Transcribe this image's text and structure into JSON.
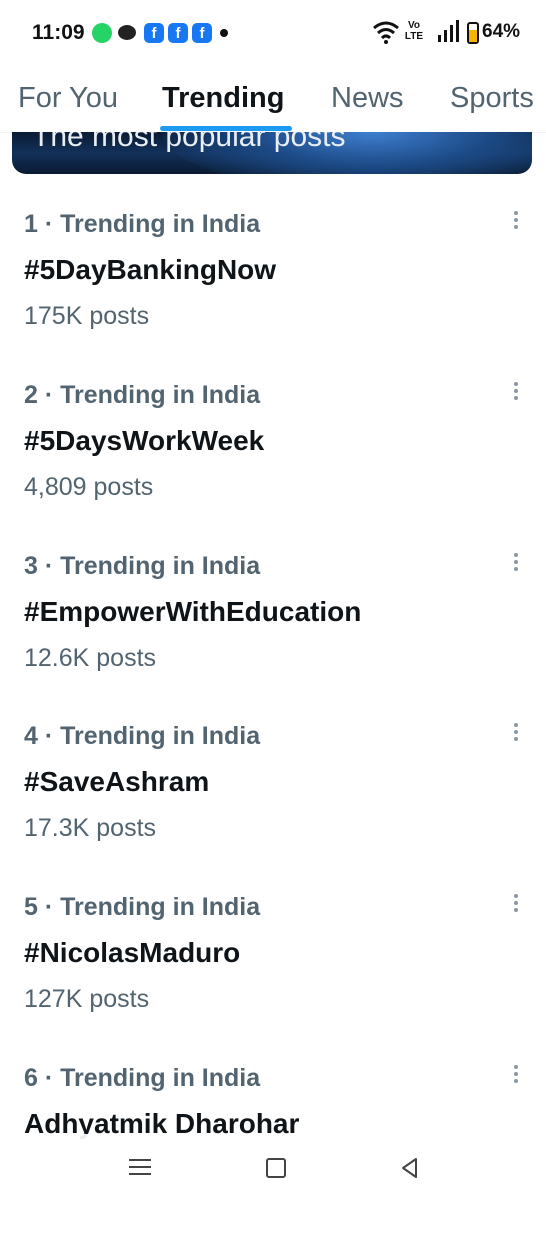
{
  "status_bar": {
    "time": "11:09",
    "volte": "Vo LTE",
    "battery": "64%",
    "battery_level": 0.64
  },
  "tabs": [
    {
      "label": "For You",
      "active": false
    },
    {
      "label": "Trending",
      "active": true
    },
    {
      "label": "News",
      "active": false
    },
    {
      "label": "Sports",
      "active": false
    }
  ],
  "banner": {
    "text": "The most popular posts"
  },
  "trends": [
    {
      "meta": "1 · Trending in India",
      "name": "#5DayBankingNow",
      "count": "175K posts"
    },
    {
      "meta": "2 · Trending in India",
      "name": "#5DaysWorkWeek",
      "count": "4,809 posts"
    },
    {
      "meta": "3 · Trending in India",
      "name": "#EmpowerWithEducation",
      "count": "12.6K posts"
    },
    {
      "meta": "4 · Trending in India",
      "name": "#SaveAshram",
      "count": "17.3K posts"
    },
    {
      "meta": "5 · Trending in India",
      "name": "#NicolasMaduro",
      "count": "127K posts"
    },
    {
      "meta": "6 · Trending in India",
      "name": "Adhyatmik Dharohar",
      "count": ""
    }
  ],
  "colors": {
    "accent": "#1d9bf0",
    "text": "#0f1419",
    "secondary": "#536471"
  }
}
